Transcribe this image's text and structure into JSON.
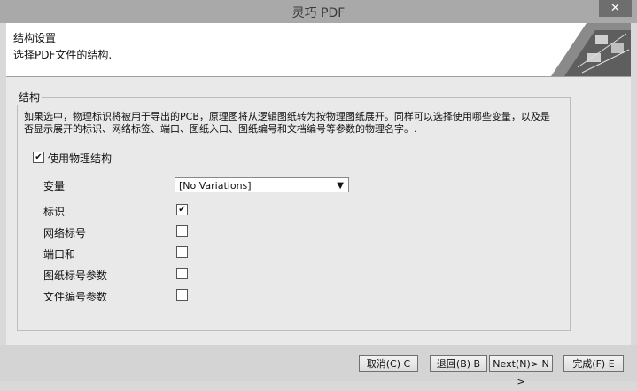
{
  "window": {
    "title": "灵巧 PDF",
    "close_glyph": "✕"
  },
  "header": {
    "title": "结构设置",
    "subtitle": "选择PDF文件的结构."
  },
  "group": {
    "label": "结构",
    "description": "如果选中，物理标识将被用于导出的PCB，原理图将从逻辑图纸转为按物理图纸展开。同样可以选择使用哪些变量，以及是否显示展开的标识、网络标签、端口、图纸入口、图纸编号和文档编号等参数的物理名字。.",
    "use_physical": {
      "label": "使用物理结构",
      "checked": true
    },
    "variable": {
      "label": "变量",
      "selected": "[No Variations]"
    },
    "options": [
      {
        "label": "标识",
        "checked": true
      },
      {
        "label": "网络标号",
        "checked": false
      },
      {
        "label": "端口和",
        "checked": false
      },
      {
        "label": "图纸标号参数",
        "checked": false
      },
      {
        "label": "文件编号参数",
        "checked": false
      }
    ]
  },
  "buttons": {
    "cancel": "取消(C) C",
    "back": "退回(B) B",
    "next": "Next(N)> N >",
    "finish": "完成(F) E"
  },
  "icons": {
    "check": "✔",
    "dropdown": "chevron-down-icon",
    "close": "close-icon"
  }
}
